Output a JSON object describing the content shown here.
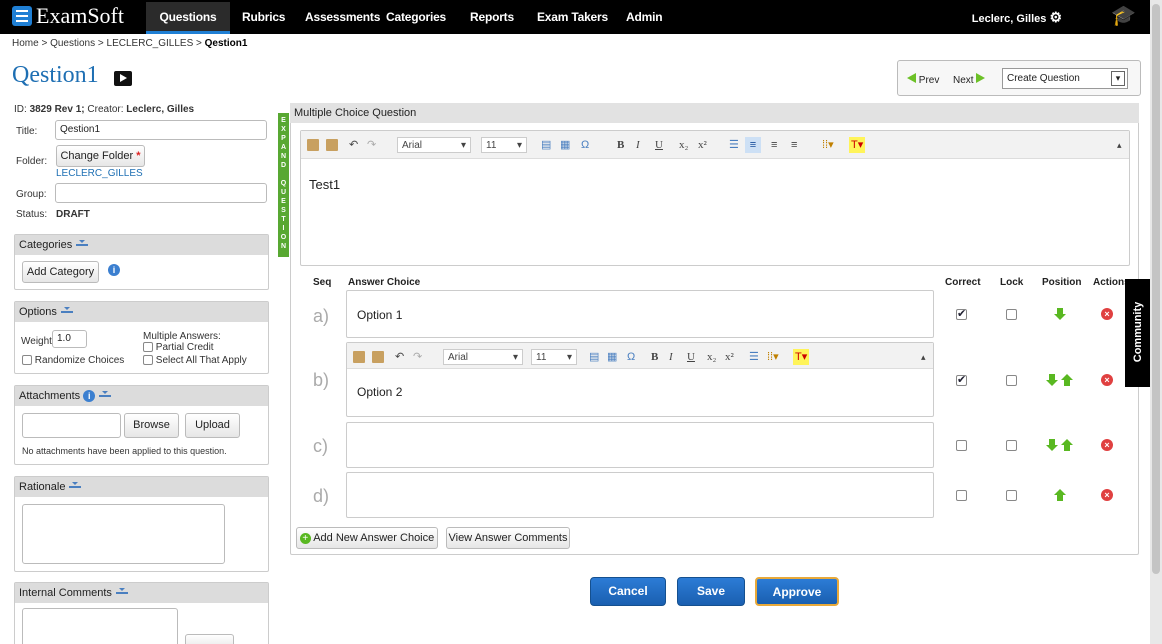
{
  "app": {
    "brand": "ExamSoft"
  },
  "nav": [
    "Questions",
    "Rubrics",
    "Assessments",
    "Categories",
    "Reports",
    "Exam Takers",
    "Admin"
  ],
  "user": {
    "name": "Leclerc, Gilles"
  },
  "breadcrumb": [
    "Home",
    "Questions",
    "LECLERC_GILLES",
    "Qestion1"
  ],
  "page": {
    "title": "Qestion1"
  },
  "toolbar_nav": {
    "prev": "Prev",
    "next": "Next",
    "create_select": "Create Question"
  },
  "meta": {
    "id_label": "ID:",
    "id_value": "3829 Rev 1;",
    "creator_label": "Creator:",
    "creator_value": "Leclerc, Gilles"
  },
  "form": {
    "title_label": "Title:",
    "title_value": "Qestion1",
    "folder_label": "Folder:",
    "change_folder": "Change Folder",
    "required_mark": "*",
    "folder_value": "LECLERC_GILLES",
    "group_label": "Group:",
    "group_value": "",
    "status_label": "Status:",
    "status_value": "DRAFT"
  },
  "categories": {
    "header": "Categories",
    "add": "Add Category"
  },
  "options": {
    "header": "Options",
    "weight_label": "Weight:",
    "weight_value": "1.0",
    "multiple_answers": "Multiple Answers:",
    "partial_credit": "Partial Credit",
    "select_all": "Select All That Apply",
    "randomize": "Randomize Choices"
  },
  "attachments": {
    "header": "Attachments",
    "browse": "Browse",
    "upload": "Upload",
    "empty": "No attachments have been applied to this question."
  },
  "rationale": {
    "header": "Rationale"
  },
  "internal_comments": {
    "header": "Internal Comments"
  },
  "question": {
    "header": "Multiple Choice Question",
    "expand_letters": [
      "E",
      "X",
      "P",
      "A",
      "N",
      "D",
      "",
      "Q",
      "U",
      "E",
      "S",
      "T",
      "I",
      "O",
      "N"
    ],
    "font": "Arial",
    "size": "11",
    "body": "Test1"
  },
  "answers": {
    "columns": {
      "seq": "Seq",
      "choice": "Answer Choice",
      "correct": "Correct",
      "lock": "Lock",
      "position": "Position",
      "actions": "Actions"
    },
    "rows": [
      {
        "seq": "a)",
        "text": "Option 1",
        "correct": true,
        "lock": false
      },
      {
        "seq": "b)",
        "text": "Option 2",
        "correct": true,
        "lock": false
      },
      {
        "seq": "c)",
        "text": "",
        "correct": false,
        "lock": false
      },
      {
        "seq": "d)",
        "text": "",
        "correct": false,
        "lock": false
      }
    ],
    "add": "Add New Answer Choice",
    "view_comments": "View Answer Comments"
  },
  "actions": {
    "cancel": "Cancel",
    "save": "Save",
    "approve": "Approve"
  },
  "community": "Community",
  "colors": {
    "brand_blue": "#1e6fb3",
    "green": "#59b821",
    "nav_bg": "#000000"
  }
}
